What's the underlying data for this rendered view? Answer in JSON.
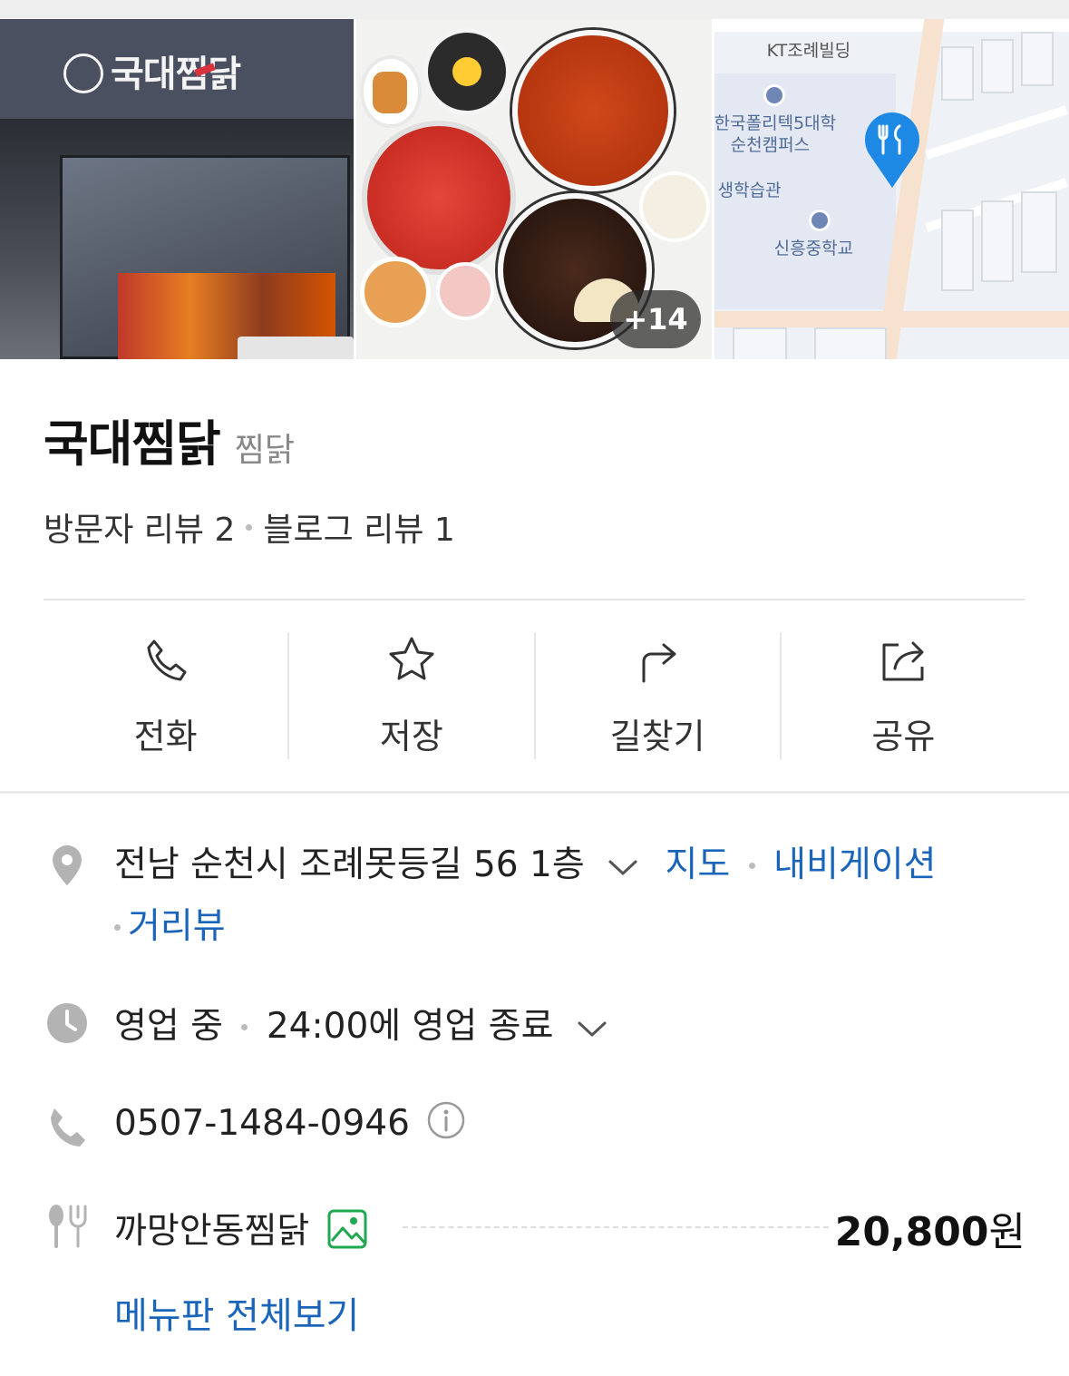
{
  "gallery": {
    "store_sign": "국대찜닭",
    "more_photos": "+14",
    "map_labels": {
      "building": "KT조례빌딩",
      "college_line1": "한국폴리텍5대학",
      "college_line2": "순천캠퍼스",
      "hall": "생학습관",
      "school": "신흥중학교"
    }
  },
  "place": {
    "name": "국대찜닭",
    "category": "찜닭",
    "visitor_reviews": "방문자 리뷰 2",
    "blog_reviews": "블로그 리뷰 1"
  },
  "actions": [
    {
      "label": "전화",
      "icon": "phone-icon"
    },
    {
      "label": "저장",
      "icon": "star-icon"
    },
    {
      "label": "길찾기",
      "icon": "directions-icon"
    },
    {
      "label": "공유",
      "icon": "share-icon"
    }
  ],
  "info": {
    "address": "전남 순천시 조례못등길 56 1층",
    "map_link": "지도",
    "navigation_link": "내비게이션",
    "street_view_link": "거리뷰",
    "status": "영업 중",
    "hours": "24:00에 영업 종료",
    "phone": "0507-1484-0946",
    "menu_item": "까망안동찜닭",
    "menu_price": "20,800",
    "price_unit": "원",
    "menu_all": "메뉴판 전체보기"
  },
  "colors": {
    "link": "#1a65b9",
    "map_pin": "#1e88e5",
    "menu_photo_icon": "#1fa84f",
    "icon_gray": "#b3b3b3"
  }
}
